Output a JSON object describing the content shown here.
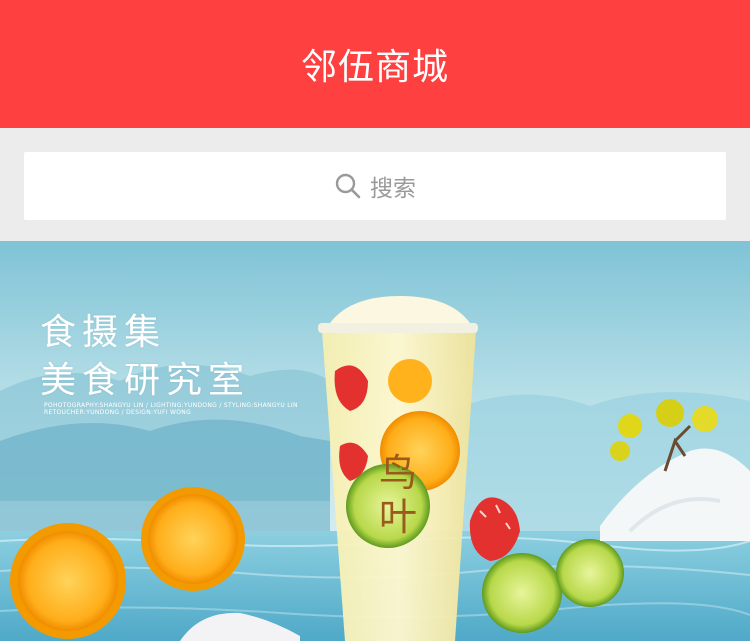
{
  "header": {
    "title": "邻伍商城"
  },
  "search": {
    "icon": "search-icon",
    "placeholder": "搜索"
  },
  "banner": {
    "line1": "食摄集",
    "line2": "美食研究室",
    "credits_line1": "POHOTOGRAPHY:SHANGYU LIN / LIGHTING:YUNDONG / STYLING:SHANGYU LIN",
    "credits_line2": "RETOUCHER:YUNDONG / DESIGN:YUFI WONG",
    "cup_logo_text": "鸟叶"
  },
  "colors": {
    "header_bg": "#ff4040",
    "page_bg": "#ececec",
    "search_bg": "#ffffff"
  }
}
